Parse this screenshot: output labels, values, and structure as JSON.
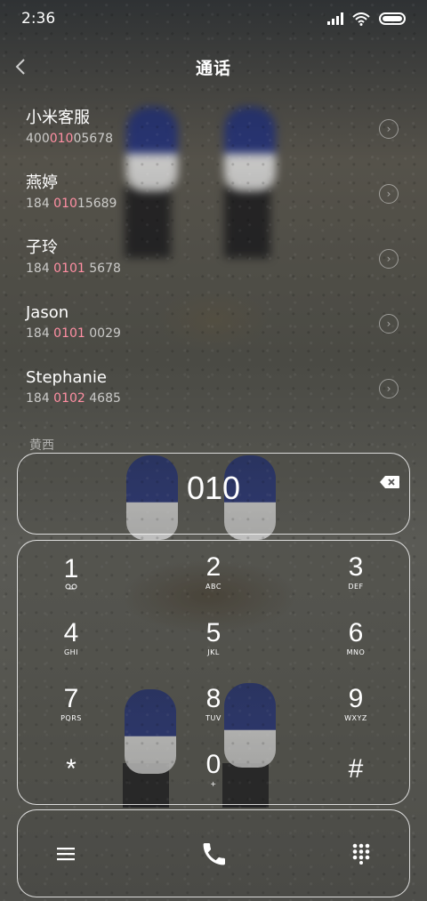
{
  "status": {
    "time": "2:36"
  },
  "header": {
    "title": "通话"
  },
  "contacts": [
    {
      "name": "小米客服",
      "num_pre": "400",
      "num_hl": "010",
      "num_post": "05678"
    },
    {
      "name": "燕婷",
      "num_pre": "184 ",
      "num_hl": "010",
      "num_post": "15689"
    },
    {
      "name": "子玲",
      "num_pre": "184 ",
      "num_hl": "0101",
      "num_post": " 5678"
    },
    {
      "name": "Jason",
      "num_pre": "184 ",
      "num_hl": "0101",
      "num_post": " 0029"
    },
    {
      "name": "Stephanie",
      "num_pre": "184 ",
      "num_hl": "0102",
      "num_post": " 4685"
    }
  ],
  "partial_contact": "黄西",
  "dial": {
    "typed": "010"
  },
  "keys": [
    {
      "digit": "1",
      "letters": ""
    },
    {
      "digit": "2",
      "letters": "ABC"
    },
    {
      "digit": "3",
      "letters": "DEF"
    },
    {
      "digit": "4",
      "letters": "GHI"
    },
    {
      "digit": "5",
      "letters": "JKL"
    },
    {
      "digit": "6",
      "letters": "MNO"
    },
    {
      "digit": "7",
      "letters": "PQRS"
    },
    {
      "digit": "8",
      "letters": "TUV"
    },
    {
      "digit": "9",
      "letters": "WXYZ"
    },
    {
      "digit": "*",
      "letters": ""
    },
    {
      "digit": "0",
      "letters": "+"
    },
    {
      "digit": "#",
      "letters": ""
    }
  ],
  "colors": {
    "highlight": "#ff8fa3",
    "panel_border": "#ffffff"
  },
  "icons": {
    "menu": "menu-icon",
    "call": "phone-icon",
    "keypad_toggle": "dialpad-icon",
    "backspace": "backspace-icon",
    "info": "chevron-right-circle-icon",
    "voicemail": "voicemail-icon"
  }
}
